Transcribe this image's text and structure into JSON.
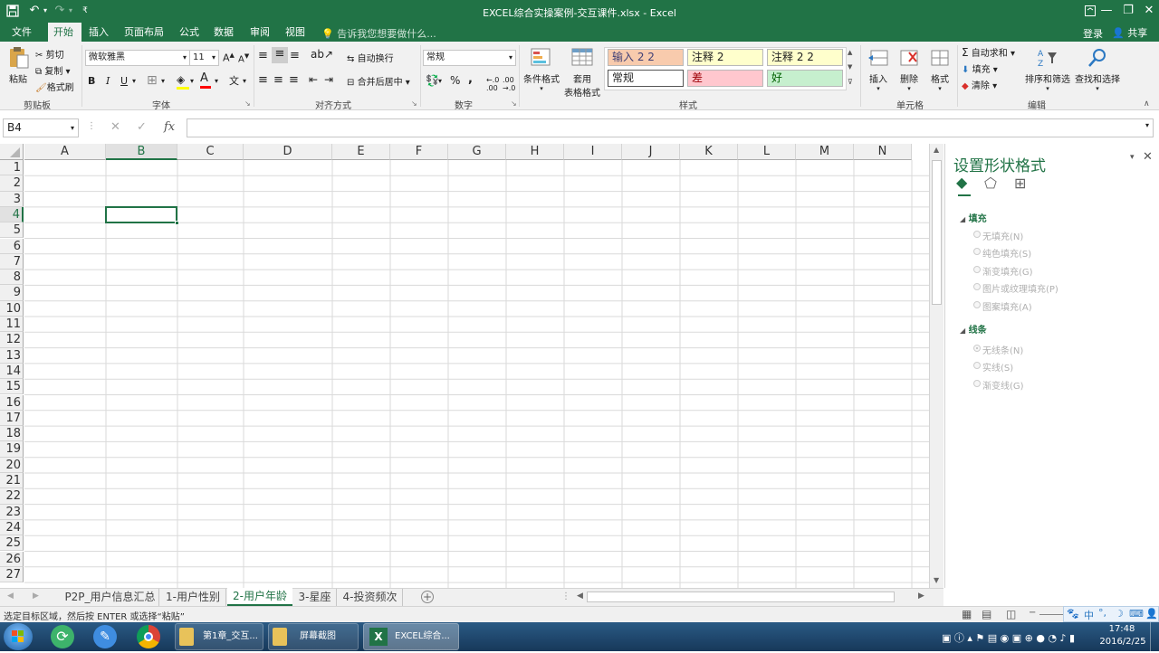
{
  "window": {
    "title": "EXCEL综合实操案例-交互课件.xlsx - Excel"
  },
  "tabs": [
    {
      "label": "文件"
    },
    {
      "label": "开始"
    },
    {
      "label": "插入"
    },
    {
      "label": "页面布局"
    },
    {
      "label": "公式"
    },
    {
      "label": "数据"
    },
    {
      "label": "审阅"
    },
    {
      "label": "视图"
    }
  ],
  "tellme": "告诉我您想要做什么...",
  "account": {
    "login": "登录",
    "share": "共享"
  },
  "ribbon": {
    "clipboard": {
      "paste": "粘贴",
      "cut": "剪切",
      "copy": "复制",
      "format_painter": "格式刷",
      "label": "剪贴板"
    },
    "font": {
      "name": "微软雅黑",
      "size": "11",
      "bold": "B",
      "italic": "I",
      "underline": "U",
      "label": "字体"
    },
    "align": {
      "wrap": "自动换行",
      "merge": "合并后居中",
      "label": "对齐方式"
    },
    "number": {
      "format": "常规",
      "percent": "%",
      "comma": ",",
      "label": "数字"
    },
    "styles": {
      "cond_format": "条件格式",
      "table_format_1": "套用",
      "table_format_2": "表格格式",
      "cells": [
        "输入 2 2",
        "注释 2",
        "注释 2 2",
        "常规",
        "差",
        "好"
      ],
      "label": "样式"
    },
    "cells": {
      "insert": "插入",
      "delete": "删除",
      "format": "格式",
      "label": "单元格"
    },
    "editing": {
      "autosum": "自动求和",
      "fill": "填充",
      "clear": "清除",
      "sort": "排序和筛选",
      "find": "查找和选择",
      "label": "编辑"
    }
  },
  "formula_bar": {
    "name_box": "B4",
    "fx": "fx",
    "value": ""
  },
  "columns": [
    "A",
    "B",
    "C",
    "D",
    "E",
    "F",
    "G",
    "H",
    "I",
    "J",
    "K",
    "L",
    "M",
    "N"
  ],
  "rows": [
    "1",
    "2",
    "3",
    "4",
    "5",
    "6",
    "7",
    "8",
    "9",
    "10",
    "11",
    "12",
    "13",
    "14",
    "15",
    "16",
    "17",
    "18",
    "19",
    "20",
    "21",
    "22",
    "23",
    "24",
    "25",
    "26",
    "27"
  ],
  "selected_cell": "B4",
  "pane": {
    "title": "设置形状格式",
    "fill_section": "填充",
    "fill_options": [
      "无填充(N)",
      "纯色填充(S)",
      "渐变填充(G)",
      "图片或纹理填充(P)",
      "图案填充(A)"
    ],
    "line_section": "线条",
    "line_options": [
      "无线条(N)",
      "实线(S)",
      "渐变线(G)"
    ]
  },
  "sheets": [
    "P2P_用户信息汇总",
    "1-用户性别",
    "2-用户年龄",
    "3-星座",
    "4-投资频次"
  ],
  "active_sheet": "2-用户年龄",
  "status": {
    "message": "选定目标区域，然后按 ENTER 或选择“粘贴”"
  },
  "taskbar": {
    "buttons": [
      "第1章_交互...",
      "屏幕截图",
      "EXCEL综合..."
    ],
    "ime": "中",
    "time": "17:48",
    "date": "2016/2/25"
  },
  "colors": {
    "excel_green": "#217346",
    "selection": "#217346"
  }
}
